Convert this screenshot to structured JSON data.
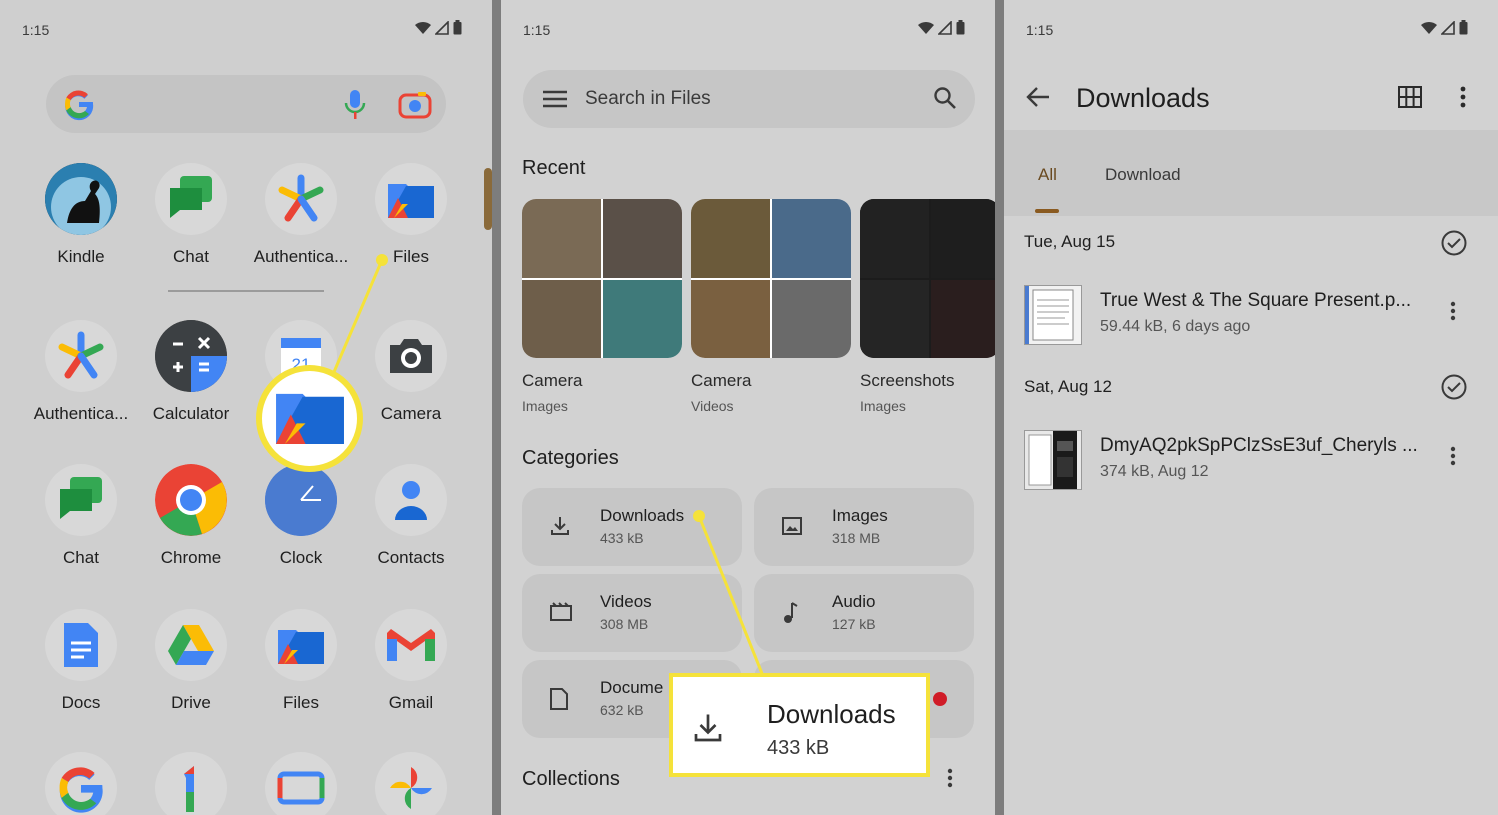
{
  "status": {
    "time": "1:15"
  },
  "launcher": {
    "row1": [
      {
        "label": "Kindle",
        "icon": "kindle-icon"
      },
      {
        "label": "Chat",
        "icon": "chat-icon"
      },
      {
        "label": "Authentica...",
        "icon": "authenticator-icon"
      },
      {
        "label": "Files",
        "icon": "files-icon"
      }
    ],
    "row2": [
      {
        "label": "Authentica...",
        "icon": "authenticator-icon"
      },
      {
        "label": "Calculator",
        "icon": "calculator-icon"
      },
      {
        "label": "",
        "icon": "calendar-icon"
      },
      {
        "label": "Camera",
        "icon": "camera-icon"
      }
    ],
    "row3": [
      {
        "label": "Chat",
        "icon": "chat-icon"
      },
      {
        "label": "Chrome",
        "icon": "chrome-icon"
      },
      {
        "label": "Clock",
        "icon": "clock-icon"
      },
      {
        "label": "Contacts",
        "icon": "contacts-icon"
      }
    ],
    "row4": [
      {
        "label": "Docs",
        "icon": "docs-icon"
      },
      {
        "label": "Drive",
        "icon": "drive-icon"
      },
      {
        "label": "Files",
        "icon": "files-icon"
      },
      {
        "label": "Gmail",
        "icon": "gmail-icon"
      }
    ],
    "calendar_day": "21"
  },
  "files": {
    "search_placeholder": "Search in Files",
    "recent_title": "Recent",
    "recent": [
      {
        "name": "Camera",
        "sub": "Images"
      },
      {
        "name": "Camera",
        "sub": "Videos"
      },
      {
        "name": "Screenshots",
        "sub": "Images"
      }
    ],
    "categories_title": "Categories",
    "categories": [
      {
        "name": "Downloads",
        "size": "433 kB",
        "icon": "download-icon"
      },
      {
        "name": "Images",
        "size": "318 MB",
        "icon": "image-icon"
      },
      {
        "name": "Videos",
        "size": "308 MB",
        "icon": "video-icon"
      },
      {
        "name": "Audio",
        "size": "127 kB",
        "icon": "audio-icon"
      },
      {
        "name": "Docume",
        "size": "632 kB",
        "icon": "document-icon"
      }
    ],
    "collections_title": "Collections",
    "callout": {
      "name": "Downloads",
      "size": "433 kB"
    }
  },
  "downloads": {
    "title": "Downloads",
    "tabs": [
      "All",
      "Download"
    ],
    "groups": [
      {
        "date": "Tue, Aug 15",
        "file": {
          "name": "True West & The Square Present.p...",
          "meta": "59.44 kB, 6 days ago"
        }
      },
      {
        "date": "Sat, Aug 12",
        "file": {
          "name": "DmyAQ2pkSpPClzSsE3uf_Cheryls ...",
          "meta": "374 kB, Aug 12"
        }
      }
    ]
  },
  "colors": {
    "highlight": "#f5e23a",
    "accent": "#8a5a20",
    "alert": "#d01c28"
  }
}
